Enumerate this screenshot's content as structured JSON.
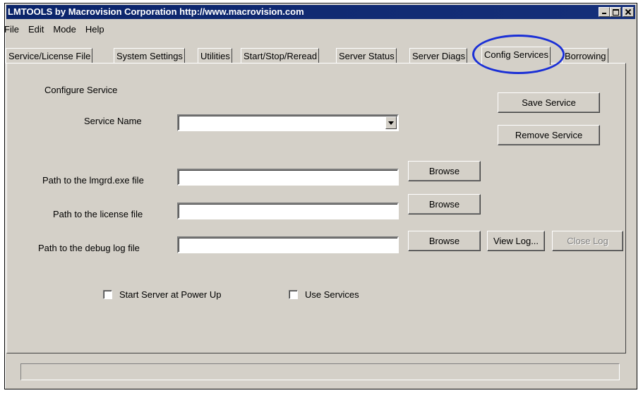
{
  "window": {
    "title": "LMTOOLS by Macrovision Corporation http://www.macrovision.com"
  },
  "menu": [
    "File",
    "Edit",
    "Mode",
    "Help"
  ],
  "tabs": [
    "Service/License File",
    "System Settings",
    "Utilities",
    "Start/Stop/Reread",
    "Server Status",
    "Server Diags",
    "Config Services",
    "Borrowing"
  ],
  "active_tab": "Config Services",
  "config": {
    "section_label": "Configure Service",
    "service_name_label": "Service Name",
    "service_name_value": "",
    "lmgrd_path_label": "Path to the lmgrd.exe file",
    "lmgrd_path_value": "",
    "license_path_label": "Path to the license file",
    "license_path_value": "",
    "debug_log_label": "Path to the debug log file",
    "debug_log_value": "",
    "save_service": "Save Service",
    "remove_service": "Remove Service",
    "browse": "Browse",
    "view_log": "View Log...",
    "close_log": "Close Log",
    "start_at_power_up": "Start Server at Power Up",
    "start_at_power_up_checked": false,
    "use_services": "Use Services",
    "use_services_checked": false
  },
  "status_text": "",
  "annotation_color": "#1a2fd6"
}
